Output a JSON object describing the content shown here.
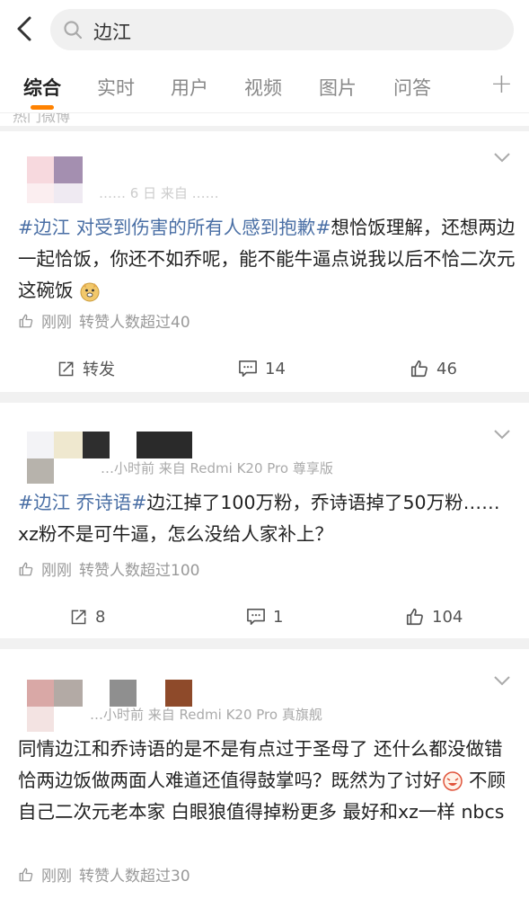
{
  "search": {
    "query": "边江"
  },
  "tabs": [
    {
      "label": "综合"
    },
    {
      "label": "实时"
    },
    {
      "label": "用户"
    },
    {
      "label": "视频"
    },
    {
      "label": "图片"
    },
    {
      "label": "问答"
    }
  ],
  "hot_label": "热门微博",
  "posts": [
    {
      "meta": "…… 6 日 来自 ……",
      "text_tag": "#边江 对受到伤害的所有人感到抱歉#",
      "text_body": "想恰饭理解，还想两边一起恰饭，你还不如乔呢，能不能牛逼点说我以后不恰二次元这碗饭",
      "time": "刚刚",
      "like_info": "转赞人数超过40",
      "repost": "转发",
      "comments": "14",
      "likes": "46"
    },
    {
      "meta": "…小时前  来自 Redmi K20 Pro 尊享版",
      "text_tag": "#边江 乔诗语#",
      "text_body": "边江掉了100万粉，乔诗语掉了50万粉……xz粉不是可牛逼，怎么没给人家补上？",
      "time": "刚刚",
      "like_info": "转赞人数超过100",
      "repost": "8",
      "comments": "1",
      "likes": "104"
    },
    {
      "meta": "…小时前  来自 Redmi K20 Pro 真旗舰",
      "text_body": "同情边江和乔诗语的是不是有点过于圣母了 还什么都没做错 恰两边饭做两面人难道还值得鼓掌吗？既然为了讨好",
      "text_body2": " 不顾自己二次元老本家 白眼狼值得掉粉更多 最好和xz一样 nbcs",
      "time": "刚刚",
      "like_info": "转赞人数超过30"
    }
  ]
}
